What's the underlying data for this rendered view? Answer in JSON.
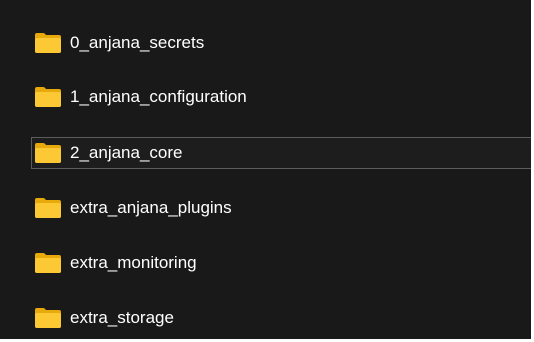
{
  "folders": [
    {
      "name": "0_anjana_secrets",
      "icon": "folder-icon",
      "selected": false
    },
    {
      "name": "1_anjana_configuration",
      "icon": "folder-icon",
      "selected": false
    },
    {
      "name": "2_anjana_core",
      "icon": "folder-icon",
      "selected": true
    },
    {
      "name": "extra_anjana_plugins",
      "icon": "folder-icon",
      "selected": false
    },
    {
      "name": "extra_monitoring",
      "icon": "folder-icon",
      "selected": false
    },
    {
      "name": "extra_storage",
      "icon": "folder-icon",
      "selected": false
    }
  ],
  "colors": {
    "background": "#191919",
    "folder_front": "#fcc834",
    "folder_back": "#e8a90b",
    "selection_border": "#5c5c5c",
    "text": "#ffffff"
  }
}
